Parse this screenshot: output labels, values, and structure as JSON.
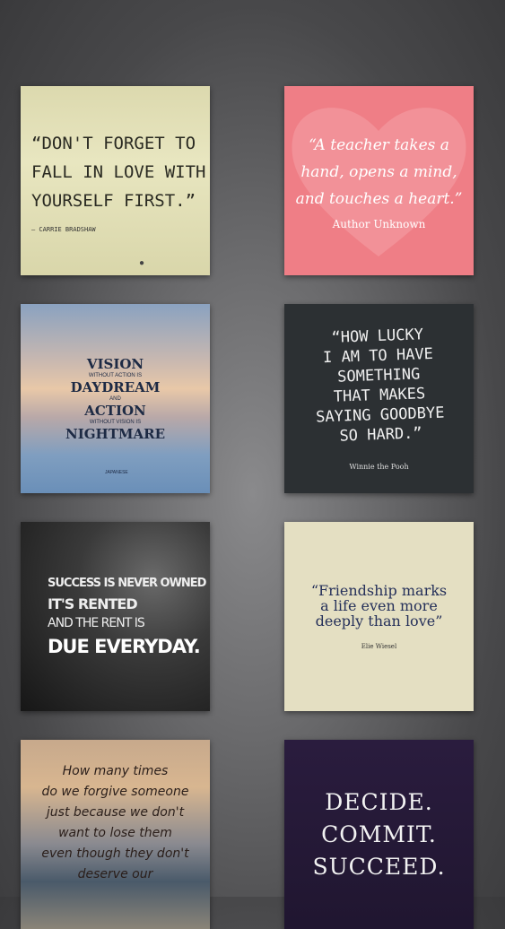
{
  "tiles": [
    {
      "id": "yourself-first",
      "lines": [
        "“DON'T FORGET TO",
        "FALL IN LOVE WITH",
        "YOURSELF FIRST.”"
      ],
      "author": "— CARRIE BRADSHAW"
    },
    {
      "id": "teacher",
      "lines": [
        "“A teacher takes a",
        "hand, opens a mind,",
        "and touches a heart.”"
      ],
      "author": "Author Unknown"
    },
    {
      "id": "vision",
      "lines": [
        "VISION",
        "WITHOUT ACTION IS",
        "DAYDREAM",
        "AND",
        "ACTION",
        "WITHOUT VISION IS",
        "NIGHTMARE"
      ],
      "author": "JAPANESE"
    },
    {
      "id": "how-lucky",
      "lines": [
        "“HOW LUCKY",
        "I AM TO HAVE",
        "SOMETHING",
        "THAT MAKES",
        "SAYING GOODBYE",
        "SO HARD.”"
      ],
      "author": "Winnie the Pooh"
    },
    {
      "id": "success",
      "lines": [
        "SUCCESS IS NEVER OWNED",
        "IT'S RENTED",
        "AND THE RENT IS",
        "DUE EVERYDAY."
      ]
    },
    {
      "id": "friendship",
      "lines": [
        "“Friendship marks",
        "a life even more",
        "deeply than love”"
      ],
      "author": "Elie Wiesel"
    },
    {
      "id": "forgive",
      "lines": [
        "How many times",
        "do we forgive someone",
        "just because we don't",
        "want to lose them",
        "even though they don't",
        "deserve our"
      ]
    },
    {
      "id": "decide",
      "lines": [
        "DECIDE.",
        "COMMIT.",
        "SUCCEED."
      ]
    }
  ]
}
